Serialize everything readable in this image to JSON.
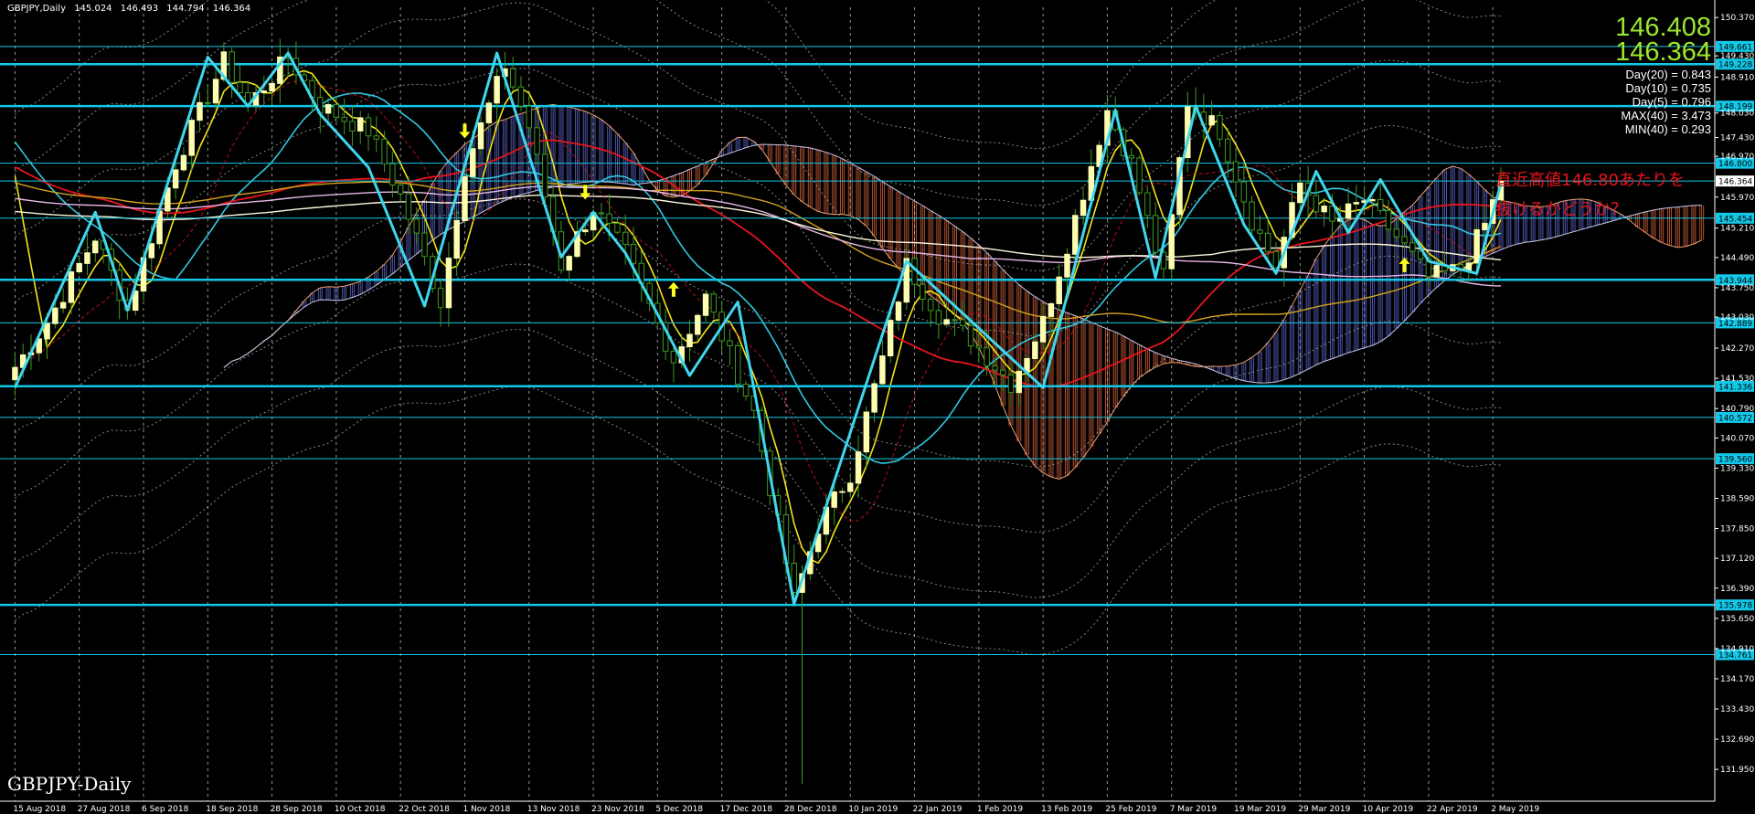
{
  "header": {
    "symbol_tf": "GBPJPY,Daily",
    "open": "145.024",
    "high": "146.493",
    "low": "144.794",
    "close": "146.364"
  },
  "watermark": "GBPJPY-Daily",
  "price_display": {
    "line1": "146.408",
    "line2": "146.364"
  },
  "stats": [
    "Day(20) = 0.843",
    "Day(10) = 0.735",
    "Day(5) = 0.796",
    "MAX(40) = 3.473",
    "MIN(40) = 0.293"
  ],
  "annotation": {
    "line1": "直近高値146.80あたりを",
    "line2": "抜けるかどうか？"
  },
  "colors": {
    "background": "#000000",
    "candle_up": "#fdfdb0",
    "candle_down": "#3e9a20",
    "zigzag": "#3fd7ee",
    "hline": "#12c8e8",
    "ma_fast": "#f2e418",
    "ma_mid": "#30c8e0",
    "ma_red": "#e8141e",
    "ma_orange": "#d4a31c",
    "ma_pink": "#e8b8e8",
    "ma_white": "#fff8dc",
    "cloud_up": "#5a64c8",
    "cloud_down": "#d0603a",
    "arrow": "#ffff20",
    "price_green": "#9be82d",
    "annotation": "#e8141e"
  },
  "chart_data": {
    "type": "candlestick",
    "title": "GBPJPY,Daily",
    "ylim": [
      131.17,
      150.62
    ],
    "y_ticks": [
      "150.370",
      "149.430",
      "148.910",
      "148.030",
      "147.430",
      "146.970",
      "145.970",
      "145.210",
      "144.490",
      "143.750",
      "143.030",
      "142.270",
      "141.530",
      "140.790",
      "140.070",
      "139.330",
      "138.590",
      "137.850",
      "137.120",
      "136.390",
      "135.650",
      "134.910",
      "134.170",
      "133.430",
      "132.690",
      "131.950"
    ],
    "x_ticks": [
      {
        "label": "15 Aug 2018",
        "bar": 0
      },
      {
        "label": "27 Aug 2018",
        "bar": 8
      },
      {
        "label": "6 Sep 2018",
        "bar": 16
      },
      {
        "label": "18 Sep 2018",
        "bar": 24
      },
      {
        "label": "28 Sep 2018",
        "bar": 32
      },
      {
        "label": "10 Oct 2018",
        "bar": 40
      },
      {
        "label": "22 Oct 2018",
        "bar": 48
      },
      {
        "label": "1 Nov 2018",
        "bar": 56
      },
      {
        "label": "13 Nov 2018",
        "bar": 64
      },
      {
        "label": "23 Nov 2018",
        "bar": 72
      },
      {
        "label": "5 Dec 2018",
        "bar": 80
      },
      {
        "label": "17 Dec 2018",
        "bar": 88
      },
      {
        "label": "28 Dec 2018",
        "bar": 96
      },
      {
        "label": "10 Jan 2019",
        "bar": 104
      },
      {
        "label": "22 Jan 2019",
        "bar": 112
      },
      {
        "label": "1 Feb 2019",
        "bar": 120
      },
      {
        "label": "13 Feb 2019",
        "bar": 128
      },
      {
        "label": "25 Feb 2019",
        "bar": 136
      },
      {
        "label": "7 Mar 2019",
        "bar": 144
      },
      {
        "label": "19 Mar 2019",
        "bar": 152
      },
      {
        "label": "29 Mar 2019",
        "bar": 160
      },
      {
        "label": "10 Apr 2019",
        "bar": 168
      },
      {
        "label": "22 Apr 2019",
        "bar": 176
      },
      {
        "label": "2 May 2019",
        "bar": 184
      }
    ],
    "bars_total": 186,
    "hlines": [
      {
        "price": 149.661,
        "label": "149.661",
        "weight": 1
      },
      {
        "price": 149.228,
        "label": "149.228",
        "weight": 3
      },
      {
        "price": 148.199,
        "label": "148.199",
        "weight": 3
      },
      {
        "price": 146.8,
        "label": "146.800",
        "weight": 1
      },
      {
        "price": 146.364,
        "label": "146.364",
        "weight": 1,
        "current": true
      },
      {
        "price": 145.454,
        "label": "145.454",
        "weight": 1
      },
      {
        "price": 143.944,
        "label": "143.944",
        "weight": 3
      },
      {
        "price": 142.889,
        "label": "142.889",
        "weight": 1
      },
      {
        "price": 141.336,
        "label": "141.336",
        "weight": 3
      },
      {
        "price": 140.572,
        "label": "140.572",
        "weight": 1
      },
      {
        "price": 139.56,
        "label": "139.560",
        "weight": 1
      },
      {
        "price": 135.978,
        "label": "135.978",
        "weight": 3
      },
      {
        "price": 134.761,
        "label": "134.761",
        "weight": 1
      }
    ],
    "anchors": [
      [
        0,
        141.8
      ],
      [
        4,
        142.9
      ],
      [
        10,
        145.0
      ],
      [
        14,
        143.2
      ],
      [
        20,
        146.8
      ],
      [
        26,
        149.3
      ],
      [
        29,
        148.2
      ],
      [
        34,
        149.4
      ],
      [
        38,
        148.2
      ],
      [
        44,
        147.6
      ],
      [
        48,
        146.0
      ],
      [
        53,
        143.4
      ],
      [
        56,
        146.7
      ],
      [
        61,
        149.2
      ],
      [
        64,
        147.7
      ],
      [
        68,
        144.3
      ],
      [
        72,
        145.7
      ],
      [
        76,
        144.6
      ],
      [
        82,
        142.0
      ],
      [
        86,
        143.5
      ],
      [
        92,
        140.7
      ],
      [
        97,
        136.1
      ],
      [
        100,
        137.9
      ],
      [
        104,
        139.2
      ],
      [
        108,
        142.0
      ],
      [
        111,
        144.3
      ],
      [
        115,
        143.1
      ],
      [
        119,
        142.5
      ],
      [
        124,
        141.4
      ],
      [
        128,
        142.9
      ],
      [
        133,
        146.1
      ],
      [
        136,
        148.1
      ],
      [
        139,
        146.8
      ],
      [
        143,
        144.0
      ],
      [
        146,
        148.3
      ],
      [
        150,
        147.6
      ],
      [
        154,
        145.4
      ],
      [
        157,
        144.3
      ],
      [
        160,
        146.3
      ],
      [
        164,
        145.3
      ],
      [
        168,
        145.9
      ],
      [
        172,
        145.0
      ],
      [
        176,
        144.0
      ],
      [
        180,
        144.2
      ],
      [
        183,
        145.3
      ],
      [
        185,
        146.36
      ]
    ],
    "zigzag": [
      [
        0,
        141.3
      ],
      [
        10,
        145.6
      ],
      [
        14,
        143.2
      ],
      [
        24,
        149.4
      ],
      [
        29,
        148.2
      ],
      [
        34,
        149.5
      ],
      [
        38,
        148.0
      ],
      [
        44,
        146.7
      ],
      [
        51,
        143.3
      ],
      [
        60,
        149.5
      ],
      [
        68,
        144.5
      ],
      [
        72,
        145.6
      ],
      [
        76,
        144.6
      ],
      [
        84,
        141.6
      ],
      [
        90,
        143.4
      ],
      [
        97,
        136.0
      ],
      [
        111,
        144.4
      ],
      [
        128,
        141.3
      ],
      [
        137,
        148.1
      ],
      [
        142,
        144.0
      ],
      [
        147,
        148.2
      ],
      [
        153,
        145.3
      ],
      [
        157,
        144.1
      ],
      [
        162,
        146.6
      ],
      [
        166,
        145.1
      ],
      [
        170,
        146.4
      ],
      [
        176,
        144.4
      ],
      [
        182,
        144.1
      ],
      [
        185,
        146.3
      ]
    ],
    "spike_low": {
      "bar": 98,
      "price": 131.6
    },
    "arrows": [
      {
        "bar": 56,
        "price": 147.5,
        "dir": "down"
      },
      {
        "bar": 71,
        "price": 146.0,
        "dir": "down"
      },
      {
        "bar": 82,
        "price": 143.8,
        "dir": "up"
      },
      {
        "bar": 173,
        "price": 144.4,
        "dir": "up"
      }
    ]
  }
}
